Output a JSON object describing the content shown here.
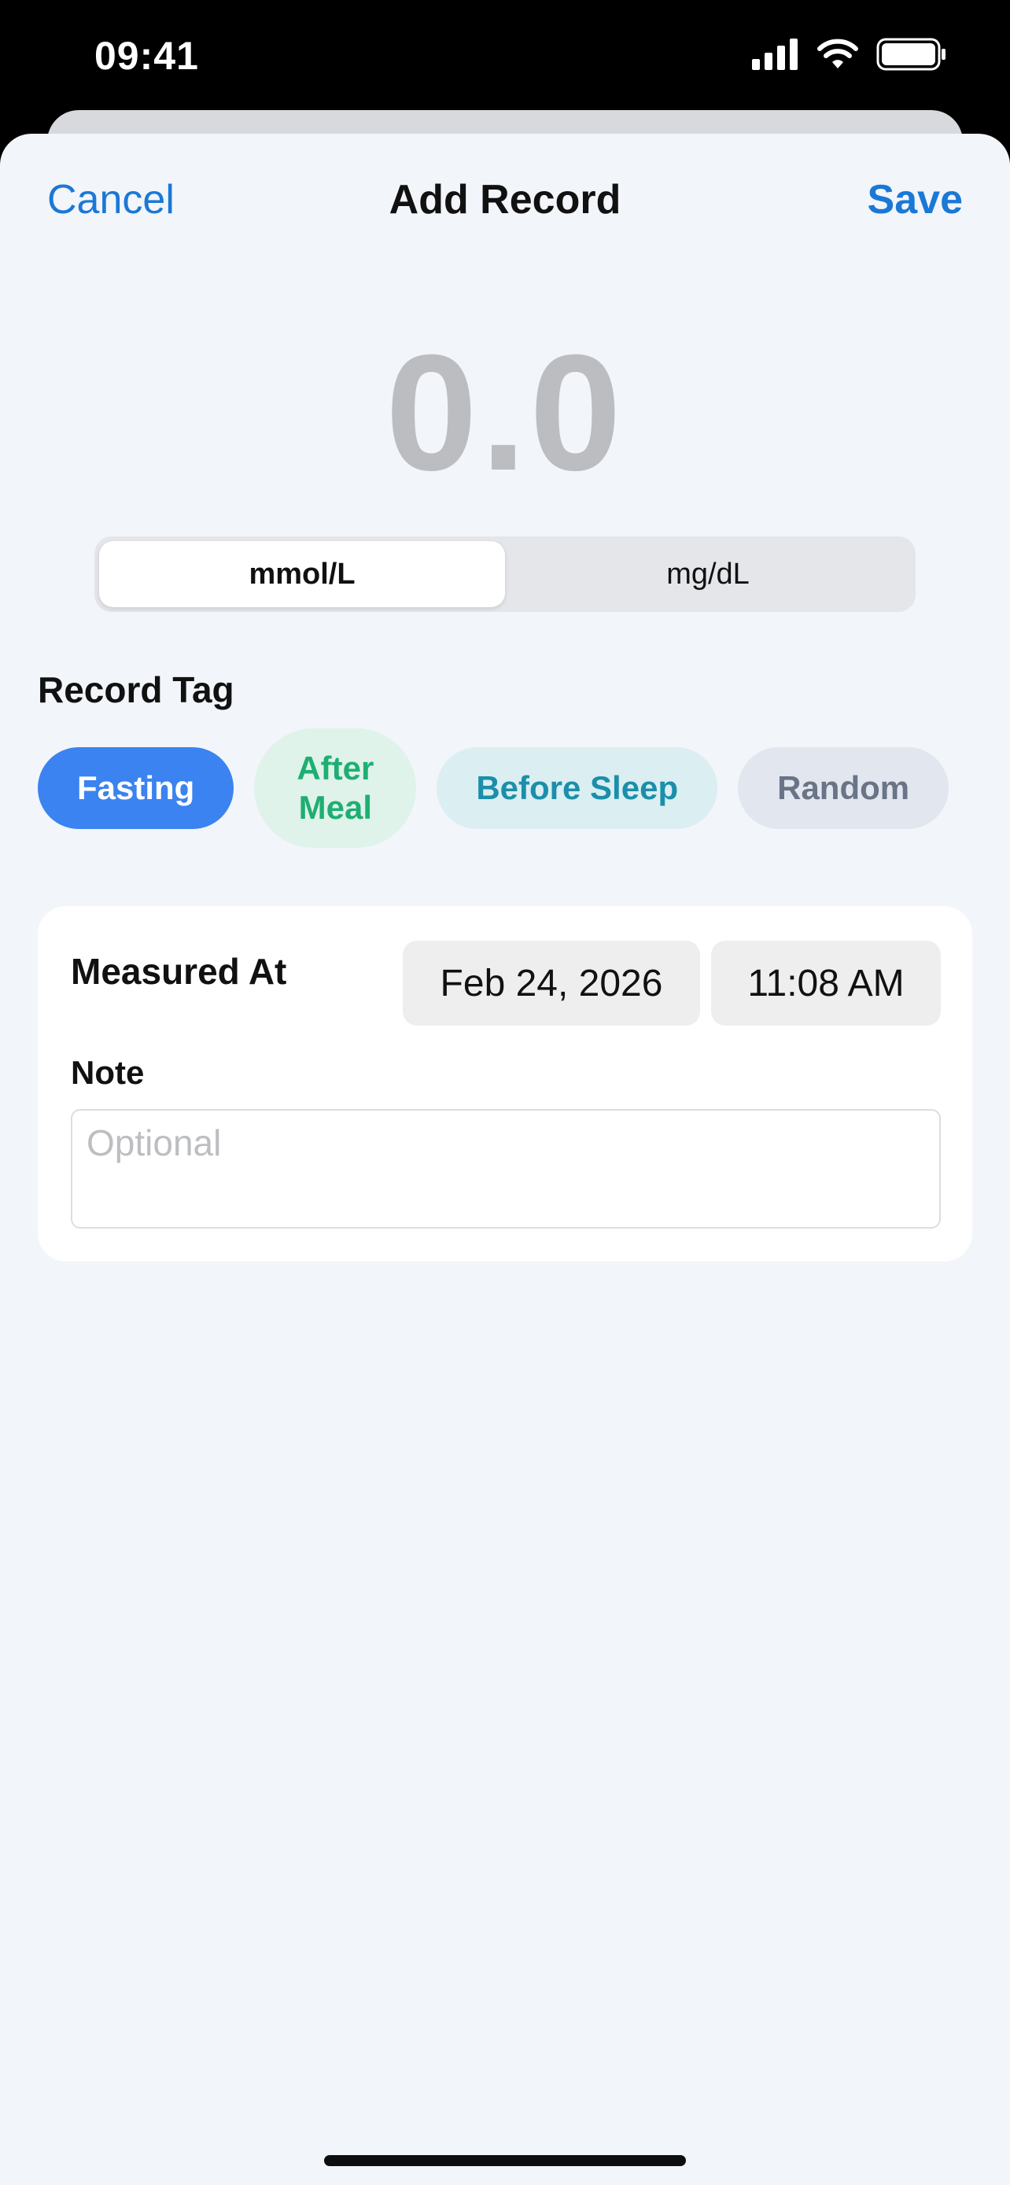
{
  "status_bar": {
    "time": "09:41"
  },
  "nav": {
    "cancel_label": "Cancel",
    "title": "Add Record",
    "save_label": "Save"
  },
  "reading": {
    "value": "0.0"
  },
  "units": {
    "options": [
      "mmol/L",
      "mg/dL"
    ],
    "selected": "mmol/L"
  },
  "record_tag": {
    "label": "Record Tag",
    "tags": [
      "Fasting",
      "After Meal",
      "Before Sleep",
      "Random"
    ],
    "selected": "Fasting"
  },
  "details": {
    "measured_label": "Measured At",
    "date": "Feb 24, 2026",
    "time": "11:08 AM",
    "note_label": "Note",
    "note_placeholder": "Optional"
  },
  "colors": {
    "accent": "#1a78d6",
    "tag_fasting": "#3a83f0",
    "tag_after_meal": "#1fae72",
    "tag_before_sleep": "#1b8fa9",
    "tag_random": "#6a7487",
    "sheet_background": "#f2f5f9"
  }
}
